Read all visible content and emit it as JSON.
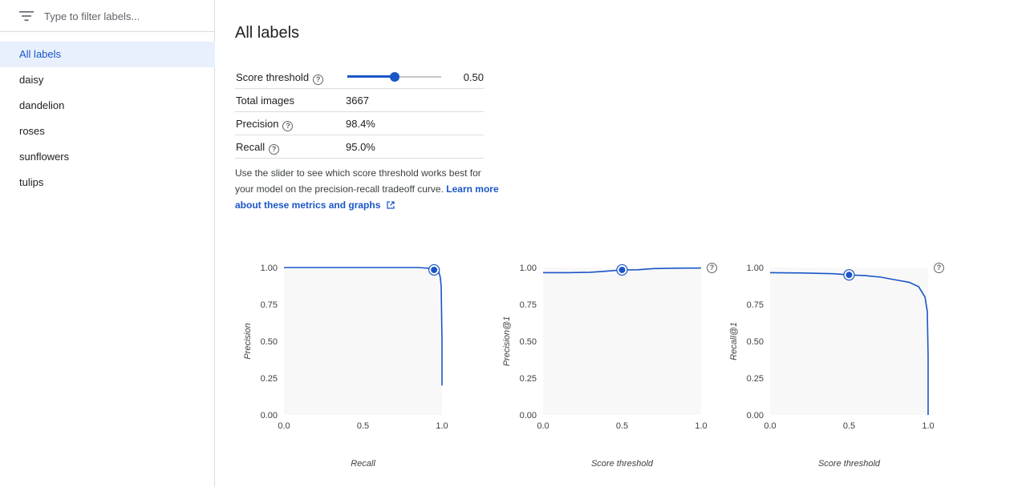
{
  "sidebar": {
    "filter_placeholder": "Type to filter labels...",
    "filter_icon": "filter-list-icon",
    "items": [
      {
        "label": "All labels",
        "active": true
      },
      {
        "label": "daisy",
        "active": false
      },
      {
        "label": "dandelion",
        "active": false
      },
      {
        "label": "roses",
        "active": false
      },
      {
        "label": "sunflowers",
        "active": false
      },
      {
        "label": "tulips",
        "active": false
      }
    ]
  },
  "main": {
    "title": "All labels",
    "metrics": {
      "score_threshold": {
        "label": "Score threshold",
        "value": "0.50",
        "fraction": 0.5
      },
      "total_images": {
        "label": "Total images",
        "value": "3667"
      },
      "precision": {
        "label": "Precision",
        "value": "98.4%"
      },
      "recall": {
        "label": "Recall",
        "value": "95.0%"
      }
    },
    "description": {
      "text": "Use the slider to see which score threshold works best for your model on the precision-recall tradeoff curve.",
      "link_text": "Learn more about these metrics and graphs",
      "link_icon": "open-in-new-icon"
    },
    "colors": {
      "accent": "#1a56c7",
      "plot_bg": "#f8f8f8"
    }
  },
  "chart_data": [
    {
      "type": "line",
      "xlabel": "Recall",
      "ylabel": "Precision",
      "xlim": [
        0,
        1
      ],
      "ylim": [
        0,
        1
      ],
      "xticks": [
        "0.0",
        "0.5",
        "1.0"
      ],
      "yticks": [
        "0.00",
        "0.25",
        "0.50",
        "0.75",
        "1.00"
      ],
      "x": [
        0,
        0.5,
        0.85,
        0.92,
        0.95,
        0.97,
        0.98,
        0.99,
        0.995,
        1.0,
        1.0
      ],
      "y": [
        1.0,
        1.0,
        1.0,
        0.995,
        0.99,
        0.984,
        0.97,
        0.93,
        0.87,
        0.5,
        0.2
      ],
      "marker": {
        "x": 0.95,
        "y": 0.984
      },
      "help": false
    },
    {
      "type": "line",
      "xlabel": "Score threshold",
      "ylabel": "Precision@1",
      "xlim": [
        0,
        1
      ],
      "ylim": [
        0,
        1
      ],
      "xticks": [
        "0.0",
        "0.5",
        "1.0"
      ],
      "yticks": [
        "0.00",
        "0.25",
        "0.50",
        "0.75",
        "1.00"
      ],
      "x": [
        0,
        0.15,
        0.3,
        0.4,
        0.5,
        0.6,
        0.7,
        0.8,
        0.9,
        0.98,
        1.0
      ],
      "y": [
        0.965,
        0.965,
        0.968,
        0.975,
        0.984,
        0.985,
        0.993,
        0.995,
        0.996,
        0.996,
        0.998
      ],
      "marker": {
        "x": 0.5,
        "y": 0.984
      },
      "help": true
    },
    {
      "type": "line",
      "xlabel": "Score threshold",
      "ylabel": "Recall@1",
      "xlim": [
        0,
        1
      ],
      "ylim": [
        0,
        1
      ],
      "xticks": [
        "0.0",
        "0.5",
        "1.0"
      ],
      "yticks": [
        "0.00",
        "0.25",
        "0.50",
        "0.75",
        "1.00"
      ],
      "x": [
        0,
        0.2,
        0.4,
        0.5,
        0.6,
        0.7,
        0.8,
        0.88,
        0.94,
        0.98,
        0.995,
        1.0,
        1.0
      ],
      "y": [
        0.965,
        0.963,
        0.958,
        0.95,
        0.945,
        0.935,
        0.915,
        0.9,
        0.87,
        0.8,
        0.7,
        0.4,
        0.0
      ],
      "marker": {
        "x": 0.5,
        "y": 0.95
      },
      "help": true
    }
  ]
}
